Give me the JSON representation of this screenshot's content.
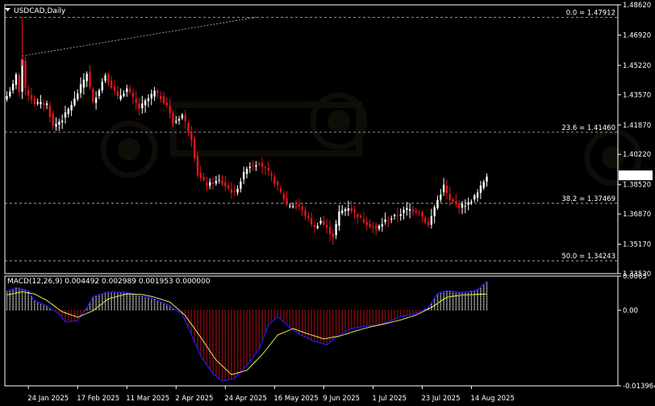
{
  "header": {
    "symbol_label": "USDCAD,Daily"
  },
  "colors": {
    "bull": "#ffffff",
    "bear": "#e8141e",
    "frame": "#ffffff",
    "macd_line": "#1a1aff",
    "signal_line": "#e6e65a",
    "fib": "#bfbfbf"
  },
  "chart_data": [
    {
      "type": "candlestick",
      "symbol": "USDCAD",
      "timeframe": "Daily",
      "ylim": [
        1.3352,
        1.4862
      ],
      "y_ticks": [
        "1.48620",
        "1.46920",
        "1.45220",
        "1.43570",
        "1.41870",
        "1.40220",
        "1.38520",
        "1.36870",
        "1.35170",
        "1.33520"
      ],
      "current_price": "1.39042",
      "fib_levels": [
        {
          "label": "0.0 = 1.47912",
          "value": 1.47912
        },
        {
          "label": "23.6 = 1.41460",
          "value": 1.4146
        },
        {
          "label": "38.2 = 1.37469",
          "value": 1.37469
        },
        {
          "label": "50.0 = 1.34243",
          "value": 1.34243
        }
      ],
      "trendline": {
        "from": [
          "2025-01-22",
          1.4575
        ],
        "to": [
          "2025-05-08",
          1.4792
        ]
      },
      "x_tick_labels": [
        "24 Jan 2025",
        "17 Feb 2025",
        "11 Mar 2025",
        "2 Apr 2025",
        "24 Apr 2025",
        "16 May 2025",
        "9 Jun 2025",
        "1 Jul 2025",
        "23 Jul 2025",
        "14 Aug 2025"
      ],
      "x_tick_dates": [
        "2025-01-24",
        "2025-02-17",
        "2025-03-11",
        "2025-04-02",
        "2025-04-24",
        "2025-05-16",
        "2025-06-09",
        "2025-07-01",
        "2025-07-23",
        "2025-08-14"
      ],
      "trading_days": {
        "first": "2025-01-15",
        "last": "2025-08-21"
      },
      "close_path": [
        [
          "2025-01-15",
          1.435
        ],
        [
          "2025-01-17",
          1.441
        ],
        [
          "2025-01-20",
          1.4465
        ],
        [
          "2025-01-21",
          1.438
        ],
        [
          "2025-01-22",
          1.4555
        ],
        [
          "2025-01-23",
          1.4385
        ],
        [
          "2025-01-28",
          1.431
        ],
        [
          "2025-02-03",
          1.4305
        ],
        [
          "2025-02-05",
          1.418
        ],
        [
          "2025-02-10",
          1.422
        ],
        [
          "2025-02-14",
          1.433
        ],
        [
          "2025-02-20",
          1.448
        ],
        [
          "2025-02-24",
          1.431
        ],
        [
          "2025-02-28",
          1.447
        ],
        [
          "2025-03-06",
          1.434
        ],
        [
          "2025-03-11",
          1.439
        ],
        [
          "2025-03-17",
          1.428
        ],
        [
          "2025-03-24",
          1.4375
        ],
        [
          "2025-03-28",
          1.43
        ],
        [
          "2025-04-01",
          1.4195
        ],
        [
          "2025-04-04",
          1.4245
        ],
        [
          "2025-04-09",
          1.411
        ],
        [
          "2025-04-11",
          1.391
        ],
        [
          "2025-04-16",
          1.385
        ],
        [
          "2025-04-22",
          1.3875
        ],
        [
          "2025-04-29",
          1.38
        ],
        [
          "2025-05-05",
          1.395
        ],
        [
          "2025-05-09",
          1.3975
        ],
        [
          "2025-05-14",
          1.392
        ],
        [
          "2025-05-19",
          1.384
        ],
        [
          "2025-05-22",
          1.374
        ],
        [
          "2025-05-28",
          1.373
        ],
        [
          "2025-06-04",
          1.361
        ],
        [
          "2025-06-06",
          1.365
        ],
        [
          "2025-06-12",
          1.356
        ],
        [
          "2025-06-16",
          1.3695
        ],
        [
          "2025-06-19",
          1.3725
        ],
        [
          "2025-06-25",
          1.366
        ],
        [
          "2025-07-02",
          1.36
        ],
        [
          "2025-07-07",
          1.365
        ],
        [
          "2025-07-11",
          1.368
        ],
        [
          "2025-07-16",
          1.3715
        ],
        [
          "2025-07-22",
          1.37
        ],
        [
          "2025-07-25",
          1.362
        ],
        [
          "2025-07-29",
          1.3725
        ],
        [
          "2025-08-01",
          1.3845
        ],
        [
          "2025-08-05",
          1.376
        ],
        [
          "2025-08-08",
          1.373
        ],
        [
          "2025-08-13",
          1.3745
        ],
        [
          "2025-08-18",
          1.3805
        ],
        [
          "2025-08-21",
          1.39042
        ]
      ]
    },
    {
      "type": "line",
      "title": "MACD(12,26,9) 0.004492 0.002989 0.001953 0.000000",
      "ylim": [
        -0.013964,
        0.0063
      ],
      "y_ticks": [
        "0.0063",
        "0.00",
        "-0.013964"
      ],
      "current_values": {
        "macd": 0.004492,
        "signal": 0.002989,
        "histogram": 0.001953
      },
      "macd_path": [
        [
          "2025-01-15",
          0.0035
        ],
        [
          "2025-01-20",
          0.0042
        ],
        [
          "2025-01-24",
          0.0036
        ],
        [
          "2025-01-28",
          0.0018
        ],
        [
          "2025-02-03",
          0.0008
        ],
        [
          "2025-02-07",
          -0.0007
        ],
        [
          "2025-02-11",
          -0.0022
        ],
        [
          "2025-02-17",
          -0.002
        ],
        [
          "2025-02-20",
          0.0005
        ],
        [
          "2025-02-24",
          0.0025
        ],
        [
          "2025-03-03",
          0.0034
        ],
        [
          "2025-03-11",
          0.0033
        ],
        [
          "2025-03-18",
          0.0026
        ],
        [
          "2025-03-24",
          0.0021
        ],
        [
          "2025-03-31",
          0.0008
        ],
        [
          "2025-04-04",
          -0.0008
        ],
        [
          "2025-04-09",
          -0.0045
        ],
        [
          "2025-04-14",
          -0.0085
        ],
        [
          "2025-04-18",
          -0.0118
        ],
        [
          "2025-04-23",
          -0.0131
        ],
        [
          "2025-04-29",
          -0.0126
        ],
        [
          "2025-05-05",
          -0.0102
        ],
        [
          "2025-05-09",
          -0.0072
        ],
        [
          "2025-05-14",
          -0.0028
        ],
        [
          "2025-05-19",
          -0.0012
        ],
        [
          "2025-05-23",
          -0.0032
        ],
        [
          "2025-05-28",
          -0.0044
        ],
        [
          "2025-06-04",
          -0.0058
        ],
        [
          "2025-06-10",
          -0.0064
        ],
        [
          "2025-06-16",
          -0.0046
        ],
        [
          "2025-06-20",
          -0.0034
        ],
        [
          "2025-06-26",
          -0.003
        ],
        [
          "2025-07-02",
          -0.0028
        ],
        [
          "2025-07-08",
          -0.0022
        ],
        [
          "2025-07-14",
          -0.0012
        ],
        [
          "2025-07-21",
          -0.0006
        ],
        [
          "2025-07-25",
          0.0005
        ],
        [
          "2025-07-30",
          0.0031
        ],
        [
          "2025-08-04",
          0.0036
        ],
        [
          "2025-08-08",
          0.0033
        ],
        [
          "2025-08-13",
          0.0034
        ],
        [
          "2025-08-18",
          0.0038
        ],
        [
          "2025-08-21",
          0.0053
        ]
      ],
      "signal_path": [
        [
          "2025-01-15",
          0.0028
        ],
        [
          "2025-01-22",
          0.0034
        ],
        [
          "2025-01-28",
          0.003
        ],
        [
          "2025-02-03",
          0.0018
        ],
        [
          "2025-02-10",
          -0.0003
        ],
        [
          "2025-02-17",
          -0.0013
        ],
        [
          "2025-02-24",
          -0.0001
        ],
        [
          "2025-03-03",
          0.0021
        ],
        [
          "2025-03-11",
          0.003
        ],
        [
          "2025-03-18",
          0.0029
        ],
        [
          "2025-03-24",
          0.0024
        ],
        [
          "2025-03-31",
          0.0015
        ],
        [
          "2025-04-07",
          -0.001
        ],
        [
          "2025-04-14",
          -0.005
        ],
        [
          "2025-04-21",
          -0.0092
        ],
        [
          "2025-04-28",
          -0.0119
        ],
        [
          "2025-05-05",
          -0.0111
        ],
        [
          "2025-05-12",
          -0.0082
        ],
        [
          "2025-05-19",
          -0.0046
        ],
        [
          "2025-05-26",
          -0.0034
        ],
        [
          "2025-06-02",
          -0.0044
        ],
        [
          "2025-06-09",
          -0.0053
        ],
        [
          "2025-06-16",
          -0.0048
        ],
        [
          "2025-06-23",
          -0.0039
        ],
        [
          "2025-06-30",
          -0.0031
        ],
        [
          "2025-07-07",
          -0.0025
        ],
        [
          "2025-07-14",
          -0.0018
        ],
        [
          "2025-07-21",
          -0.0009
        ],
        [
          "2025-07-28",
          0.0005
        ],
        [
          "2025-08-04",
          0.0024
        ],
        [
          "2025-08-11",
          0.0028
        ],
        [
          "2025-08-18",
          0.0029
        ],
        [
          "2025-08-21",
          0.003
        ]
      ]
    }
  ]
}
